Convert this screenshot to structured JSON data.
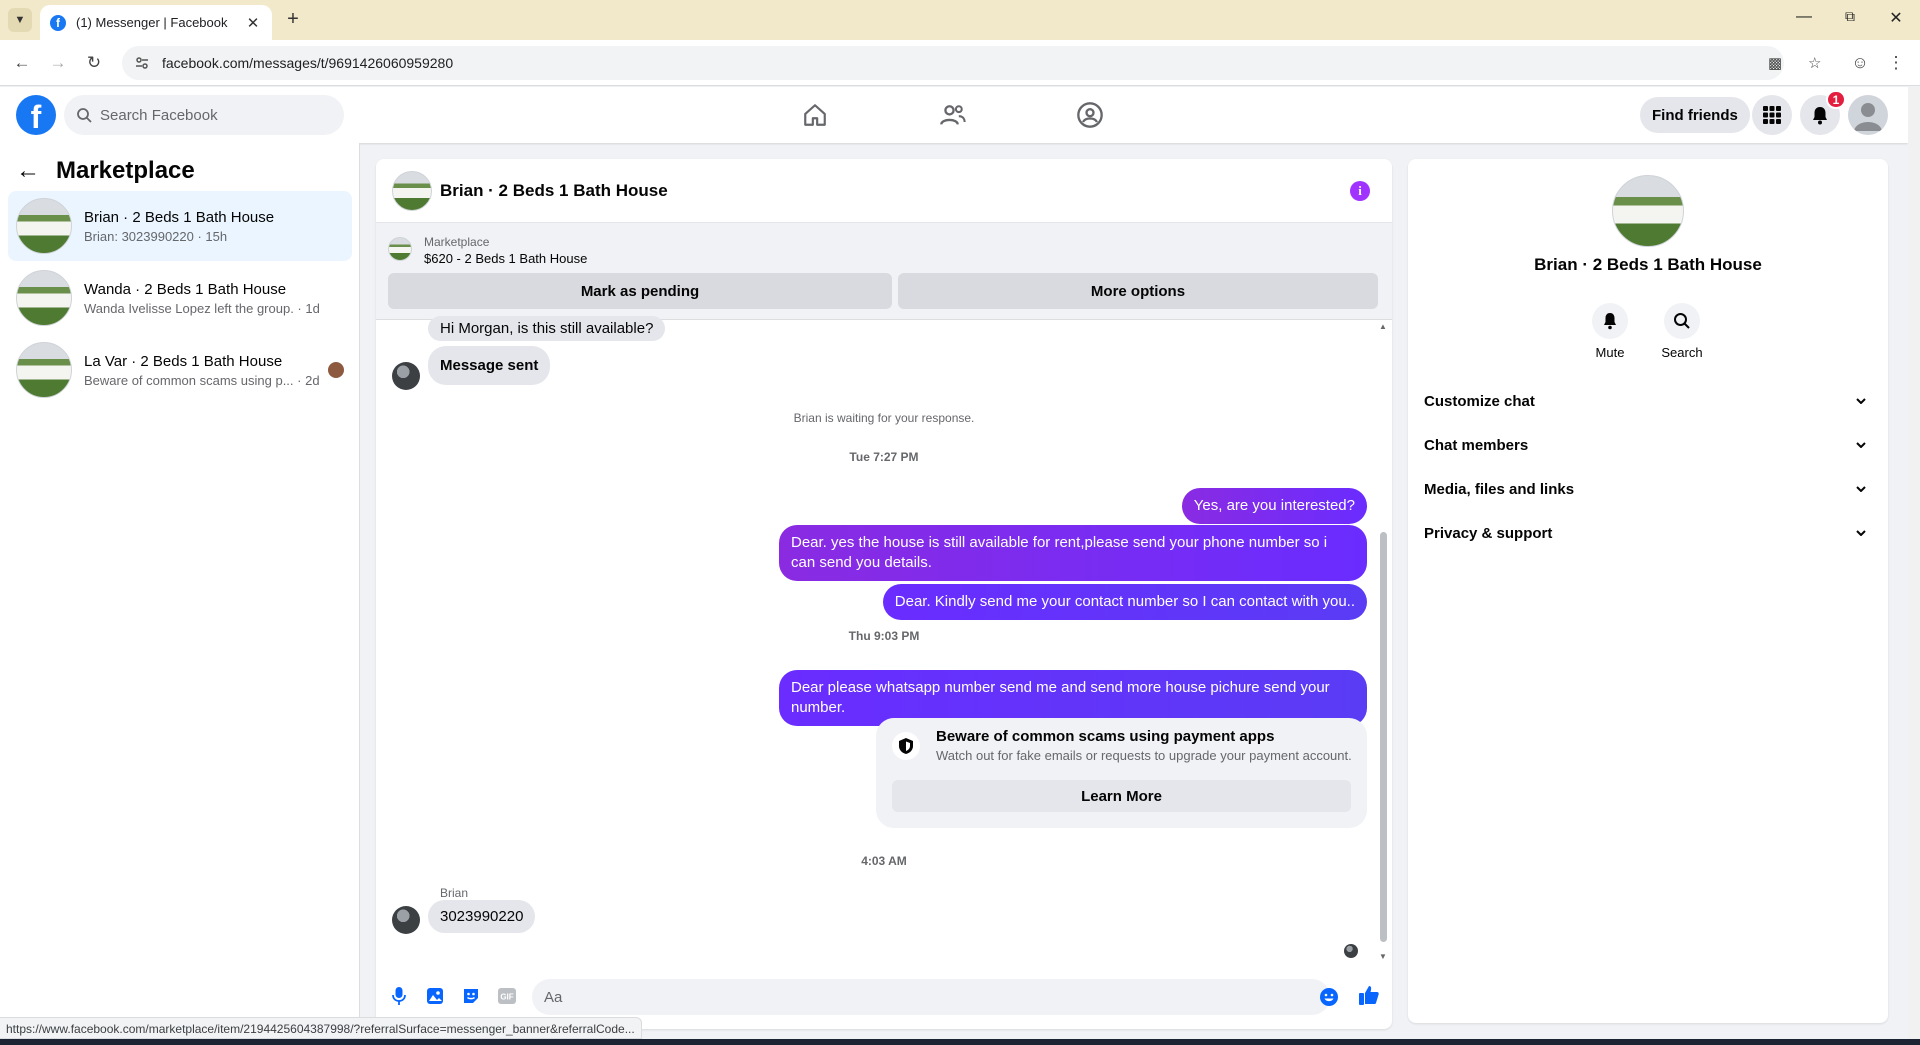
{
  "browser": {
    "tab_title": "(1) Messenger | Facebook",
    "url": "facebook.com/messages/t/9691426060959280",
    "status_url": "https://www.facebook.com/marketplace/item/2194425604387998/?referralSurface=messenger_banner&referralCode..."
  },
  "header": {
    "search_placeholder": "Search Facebook",
    "find_friends": "Find friends",
    "notification_count": "1"
  },
  "sidebar": {
    "title": "Marketplace",
    "conversations": [
      {
        "name": "Brian · 2 Beds 1 Bath House",
        "preview": "Brian: 3023990220 · 15h"
      },
      {
        "name": "Wanda · 2 Beds 1 Bath House",
        "preview": "Wanda Ivelisse Lopez left the group. · 1d"
      },
      {
        "name": "La Var · 2 Beds 1 Bath House",
        "preview": "Beware of common scams using p...",
        "time": "· 2d"
      }
    ]
  },
  "chat": {
    "title": "Brian · 2 Beds 1 Bath House",
    "marketplace_label": "Marketplace",
    "listing": "$620 - 2 Beds 1 Bath House",
    "mark_pending": "Mark as pending",
    "more_options": "More options",
    "messages": {
      "in1": "Hi Morgan, is this still available?",
      "in2": "Message sent",
      "waiting": "Brian is waiting for your response.",
      "time1": "Tue 7:27 PM",
      "out1": "Yes, are you interested?",
      "out2": "Dear. yes the house is still available for rent,please send your  phone number so i can send you details.",
      "out3": "Dear. Kindly send me your contact number so I can contact with you..",
      "time2": "Thu 9:03 PM",
      "out4": "Dear please whatsapp number send me and send more house pichure send your number.",
      "scam_title": "Beware of common scams using payment apps",
      "scam_sub": "Watch out for fake emails or requests to upgrade your payment account.",
      "learn_more": "Learn More",
      "time3": "4:03 AM",
      "sender": "Brian",
      "in3": "3023990220"
    },
    "composer_placeholder": "Aa"
  },
  "details": {
    "name": "Brian · 2 Beds 1 Bath House",
    "mute": "Mute",
    "search": "Search",
    "sections": [
      "Customize chat",
      "Chat members",
      "Media, files and links",
      "Privacy & support"
    ]
  },
  "colors": {
    "fb_blue": "#1877f2",
    "bubble_purple": "#7a2cf0",
    "badge_red": "#e41e3f"
  }
}
